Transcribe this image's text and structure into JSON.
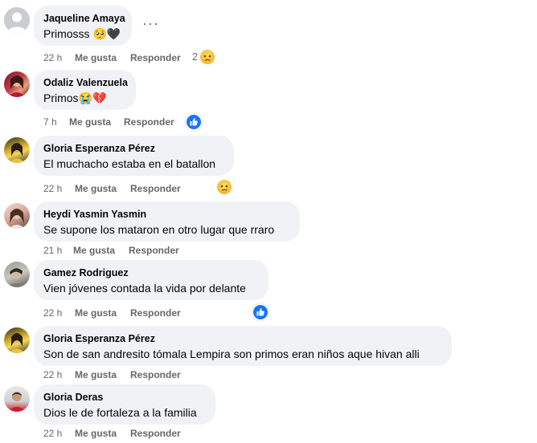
{
  "comments": [
    {
      "name": "Jaqueline Amaya",
      "text": "Primosss 🥺🖤",
      "time": "22 h",
      "like": "Me gusta",
      "reply": "Responder",
      "reaction_count": "2",
      "reaction": "sad",
      "avatar": "default"
    },
    {
      "name": "Odaliz Valenzuela",
      "text": "Primos😭💔",
      "time": "7 h",
      "like": "Me gusta",
      "reply": "Responder",
      "reaction": "like",
      "avatar": "photo-red"
    },
    {
      "name": "Gloria Esperanza Pérez",
      "text": "El muchacho estaba en el batallon",
      "time": "22 h",
      "like": "Me gusta",
      "reply": "Responder",
      "reaction": "sad",
      "avatar": "photo-yellow"
    },
    {
      "name": "Heydi Yasmin Yasmin",
      "text": "Se supone los mataron en otro lugar que rraro",
      "time": "21 h",
      "like": "Me gusta",
      "reply": "Responder",
      "avatar": "photo-pink"
    },
    {
      "name": "Gamez Rodriguez",
      "text": "Vien jóvenes contada la vida por delante",
      "time": "22 h",
      "like": "Me gusta",
      "reply": "Responder",
      "reaction": "like",
      "avatar": "photo-gray"
    },
    {
      "name": "Gloria Esperanza Pérez",
      "text": "Son de san andresito tómala Lempira son primos eran niños aque hivan alli",
      "time": "22 h",
      "like": "Me gusta",
      "reply": "Responder",
      "avatar": "photo-yellow"
    },
    {
      "name": "Gloria Deras",
      "text": "Dios le de fortaleza a la familia",
      "time": "22 h",
      "like": "Me gusta",
      "reply": "Responder",
      "avatar": "photo-red-shirt"
    }
  ],
  "more_options_label": "···",
  "colors": {
    "bubble": "#f0f2f5",
    "meta": "#65676b",
    "like_blue": "#1877f2"
  }
}
